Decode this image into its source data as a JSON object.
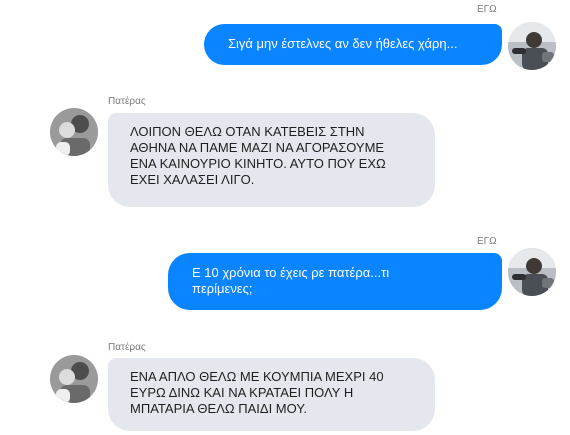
{
  "messages": [
    {
      "sender": "ΕΓΩ",
      "direction": "out",
      "text": "Σιγά μην έστελνες αν δεν ήθελες χάρη..."
    },
    {
      "sender": "Πατέρας",
      "direction": "in",
      "text": "ΛΟΙΠΟΝ ΘΕΛΩ ΟΤΑΝ ΚΑΤΕΒΕΙΣ ΣΤΗΝ\nΑΘΗΝΑ ΝΑ ΠΑΜΕ ΜΑΖΙ ΝΑ ΑΓΟΡΑΣΟΥΜΕ\nΕΝΑ ΚΑΙΝΟΥΡΙΟ ΚΙΝΗΤΟ. ΑΥΤΟ ΠΟΥ ΕΧΩ\nΕΧΕΙ ΧΑΛΑΣΕΙ ΛΙΓΟ."
    },
    {
      "sender": "ΕΓΩ",
      "direction": "out",
      "text": "Ε 10 χρόνια το έχεις ρε πατέρα...τι\nπερίμενες;"
    },
    {
      "sender": "Πατέρας",
      "direction": "in",
      "text": "ΕΝΑ ΑΠΛΟ ΘΕΛΩ ΜΕ ΚΟΥΜΠΙΑ ΜΕΧΡΙ 40\nΕΥΡΩ ΔΙΝΩ ΚΑΙ ΝΑ ΚΡΑΤΑΕΙ ΠΟΛΥ Η\nΜΠΑΤΑΡΙΑ ΘΕΛΩ ΠΑΙΔΙ ΜΟΥ."
    }
  ],
  "colors": {
    "outgoing_bubble": "#0a84ff",
    "incoming_bubble": "#e4e8ee",
    "name_text": "#7b7b7b"
  },
  "icons": {
    "me_avatar": "avatar-me-icon",
    "father_avatar": "avatar-father-icon"
  }
}
